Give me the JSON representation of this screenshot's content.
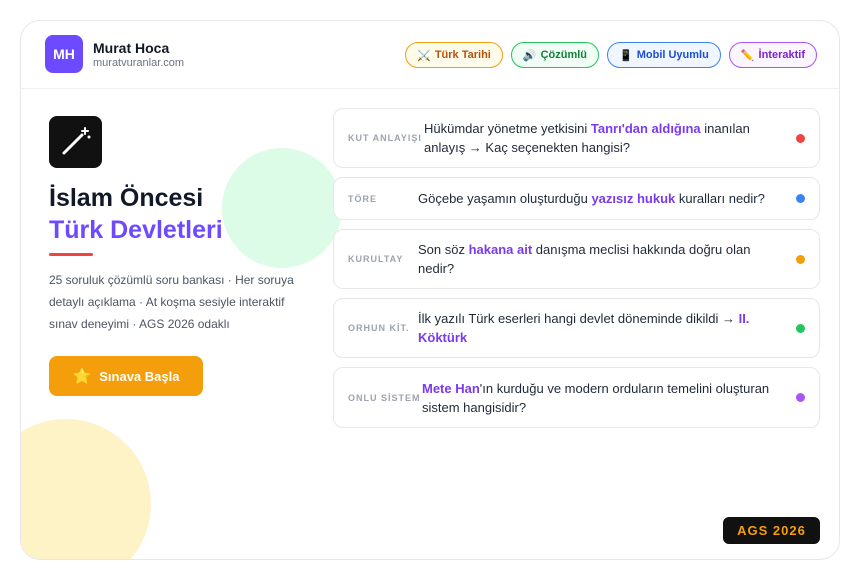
{
  "header": {
    "avatar_initials": "MH",
    "name": "Murat Hoca",
    "url": "muratvuranlar.com",
    "pills": [
      {
        "icon": "⚔️",
        "icon_name": "crossed-swords-icon",
        "label": "Türk Tarihi",
        "color": "#b45309",
        "border": "#f59e0b",
        "bg": "#fffbeb"
      },
      {
        "icon": "🔊",
        "icon_name": "speaker-icon",
        "label": "Çözümlü",
        "color": "#15803d",
        "border": "#22c55e",
        "bg": "#f0fdf4"
      },
      {
        "icon": "📱",
        "icon_name": "mobile-phone-icon",
        "label": "Mobil Uyumlu",
        "color": "#1d4ed8",
        "border": "#3b82f6",
        "bg": "#eff6ff"
      },
      {
        "icon": "✏️",
        "icon_name": "pencil-icon",
        "label": "İnteraktif",
        "color": "#7e22ce",
        "border": "#a855f7",
        "bg": "#faf5ff"
      }
    ]
  },
  "hero": {
    "icon_name": "magic-wand-icon",
    "title_line1": "İslam Öncesi",
    "title_line2": "Türk Devletleri",
    "description": "25 soruluk çözümlü soru bankası · Her soruya detaylı açıklama · At koşma sesiyle interaktif sınav deneyimi · AGS 2026 odaklı",
    "button_icon": "⭐",
    "button_label": "Sınava Başla"
  },
  "questions": [
    {
      "tag": "KUT ANLAYIŞI",
      "parts": [
        [
          "Hükümdar yönetme yetkisini ",
          false
        ],
        [
          "Tanrı'dan aldığına",
          true
        ],
        [
          " inanılan anlayış → Kaç seçenekten hangisi?",
          false
        ]
      ],
      "dot": "#ef4444"
    },
    {
      "tag": "TÖRE",
      "parts": [
        [
          "Göçebe yaşamın oluşturduğu ",
          false
        ],
        [
          "yazısız hukuk",
          true
        ],
        [
          " kuralları nedir?",
          false
        ]
      ],
      "dot": "#3b82f6"
    },
    {
      "tag": "KURULTAY",
      "parts": [
        [
          "Son söz ",
          false
        ],
        [
          "hakana ait",
          true
        ],
        [
          " danışma meclisi hakkında doğru olan nedir?",
          false
        ]
      ],
      "dot": "#f59e0b"
    },
    {
      "tag": "ORHUN KİT.",
      "parts": [
        [
          "İlk yazılı Türk eserleri hangi devlet döneminde dikildi → ",
          false
        ],
        [
          "II. Köktürk",
          true
        ]
      ],
      "dot": "#22c55e"
    },
    {
      "tag": "ONLU SİSTEM",
      "parts": [
        [
          "Mete Han",
          true
        ],
        [
          "'ın kurduğu ve modern orduların temelini oluşturan sistem hangisidir?",
          false
        ]
      ],
      "dot": "#a855f7"
    }
  ],
  "badge": "AGS 2026"
}
